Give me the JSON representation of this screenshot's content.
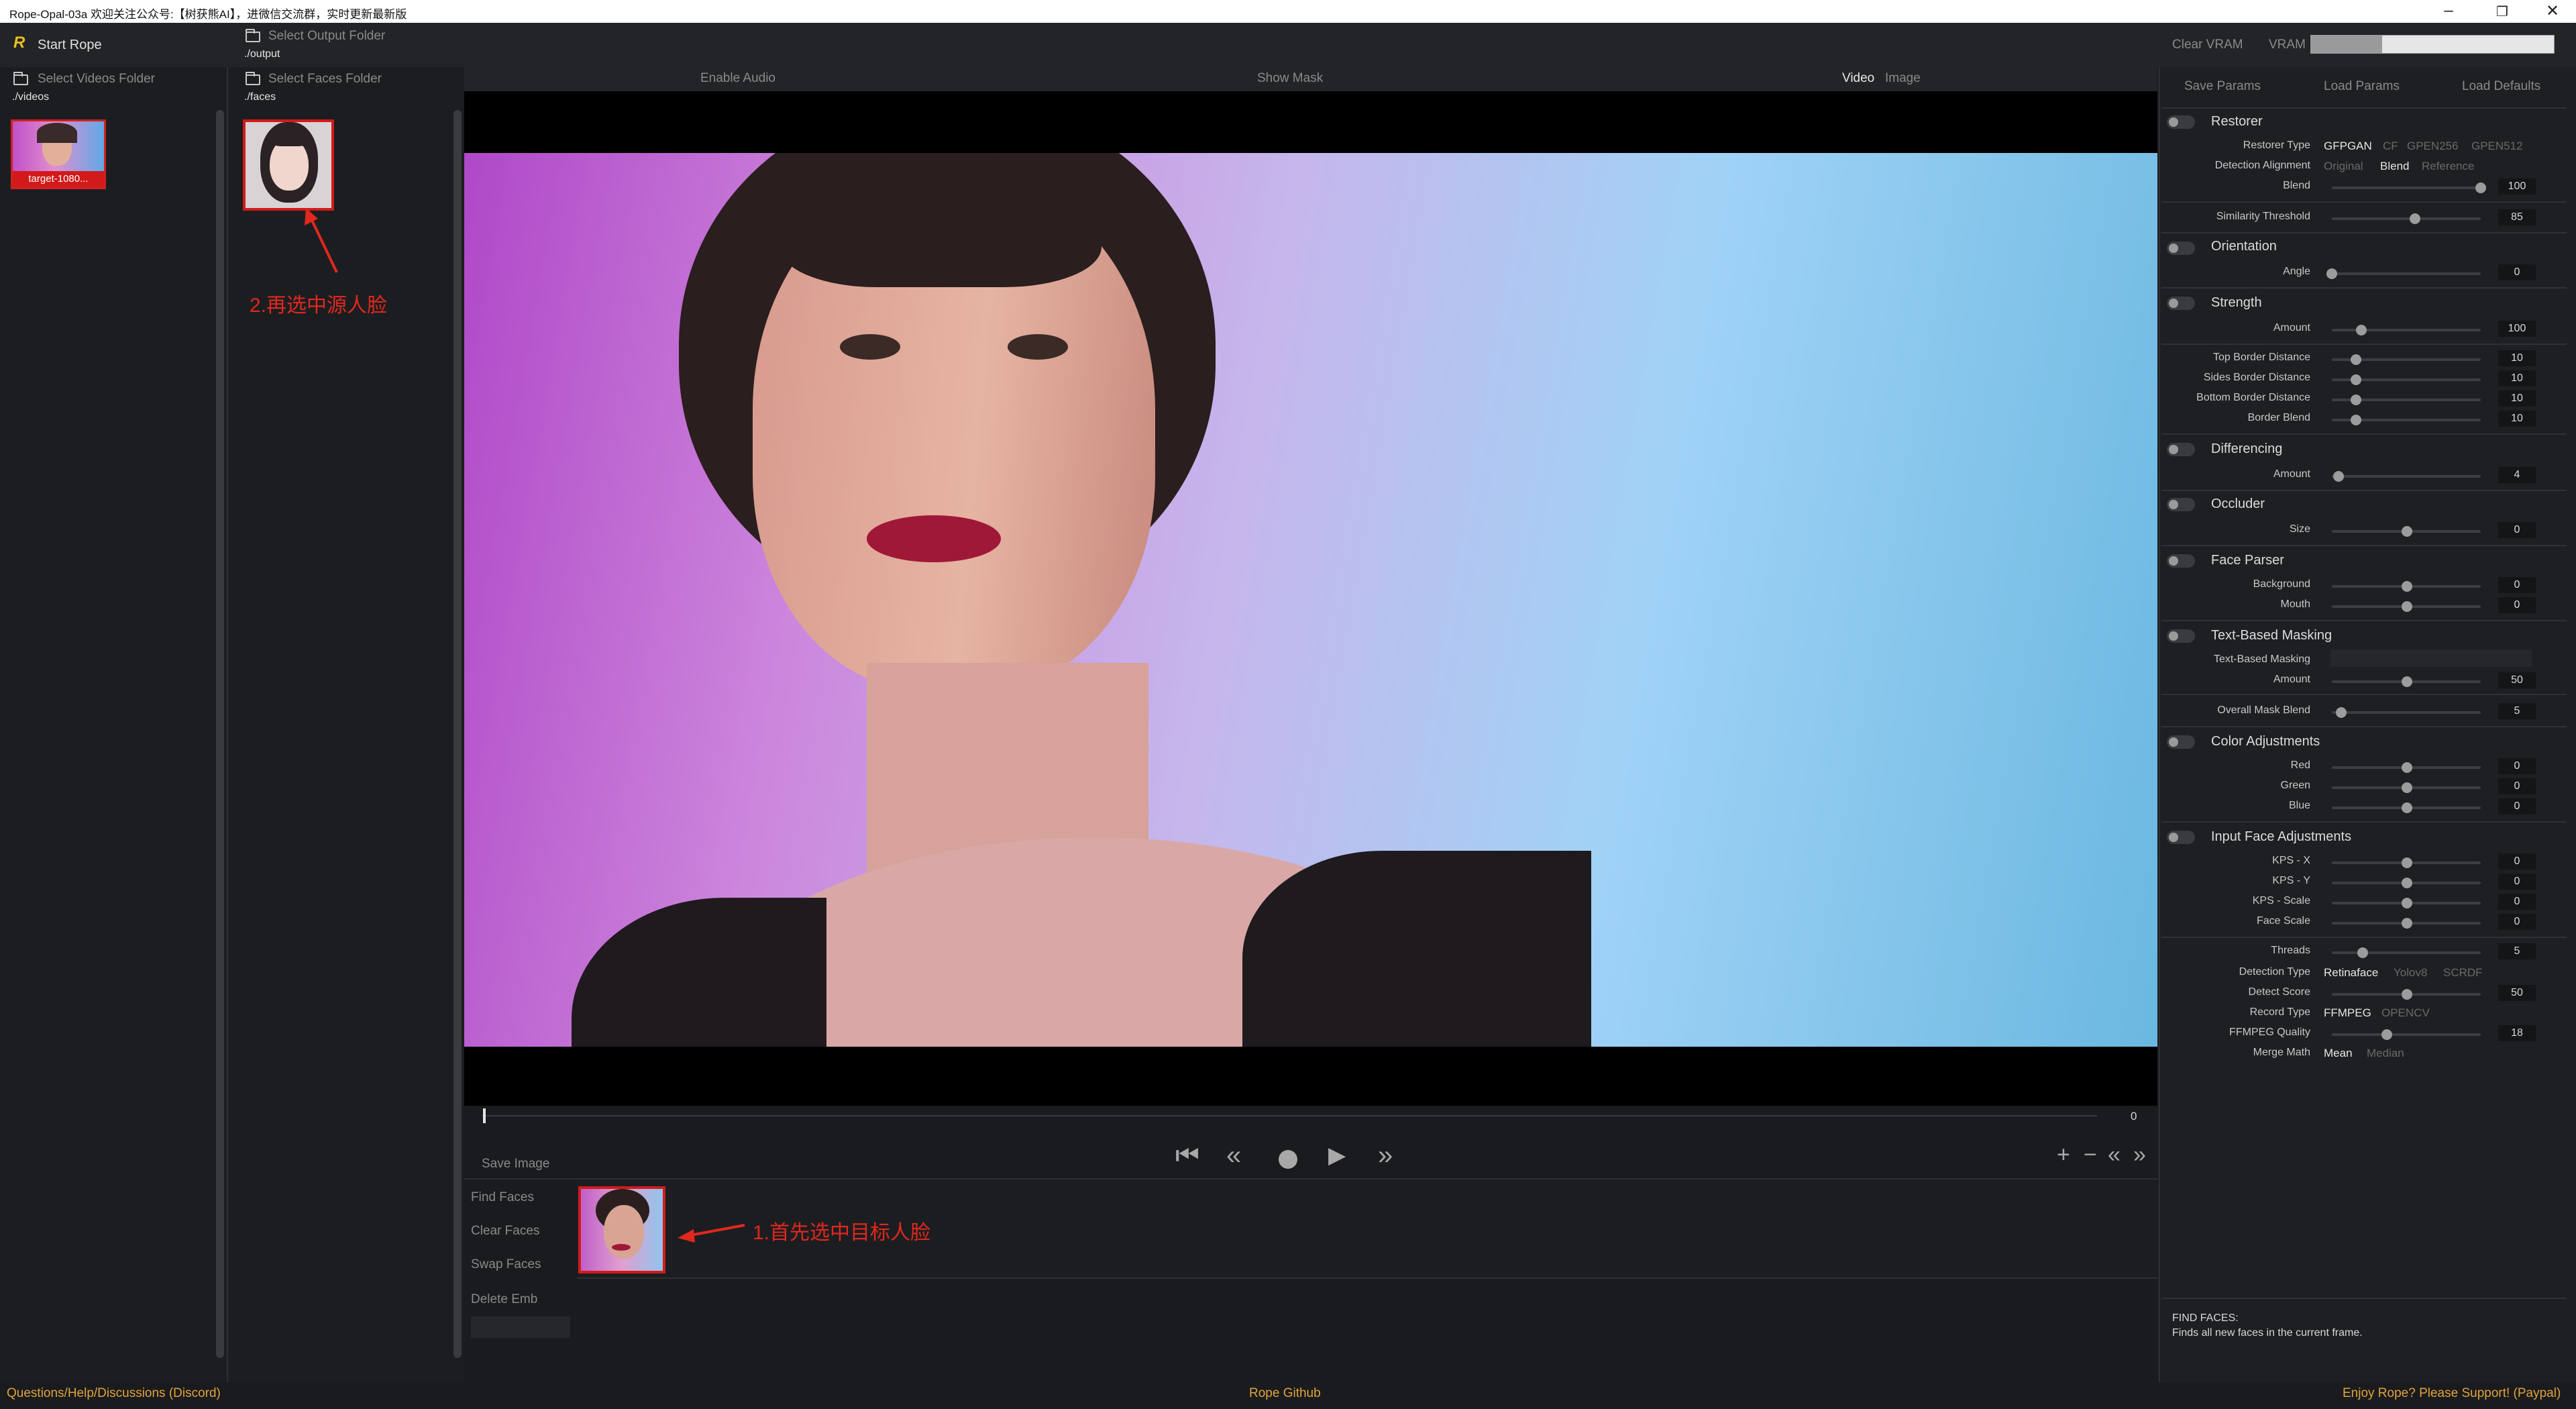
{
  "window": {
    "title": "Rope-Opal-03a  欢迎关注公众号:【树获熊AI】，进微信交流群，实时更新最新版"
  },
  "topbar": {
    "start_rope": "Start Rope",
    "select_output_folder": "Select Output Folder",
    "output_path": "./output",
    "clear_vram": "Clear VRAM",
    "vram_label": "VRAM"
  },
  "left": {
    "select_videos_folder": "Select Videos Folder",
    "videos_path": "./videos",
    "video_thumb_label": "target-1080...",
    "select_faces_folder": "Select Faces Folder",
    "faces_path": "./faces"
  },
  "center_top": {
    "enable_audio": "Enable Audio",
    "show_mask": "Show Mask",
    "video_tab": "Video",
    "image_tab": "Image"
  },
  "timeline": {
    "frame_value": "0"
  },
  "controls": {
    "save_image": "Save Image"
  },
  "faces": {
    "find_faces": "Find Faces",
    "clear_faces": "Clear Faces",
    "swap_faces": "Swap Faces",
    "delete_emb": "Delete Emb"
  },
  "annotations": {
    "source_face": "2.再选中源人脸",
    "target_face": "1.首先选中目标人脸",
    "color": "#e0281e"
  },
  "params_header": {
    "save_params": "Save Params",
    "load_params": "Load Params",
    "load_defaults": "Load Defaults"
  },
  "params": {
    "restorer": {
      "title": "Restorer",
      "type_label": "Restorer Type",
      "types": [
        "GFPGAN",
        "CF",
        "GPEN256",
        "GPEN512"
      ],
      "align_label": "Detection Alignment",
      "aligns": [
        "Original",
        "Blend",
        "Reference"
      ],
      "blend_label": "Blend",
      "blend": "100",
      "blend_level": 1.0
    },
    "similarity": {
      "label": "Similarity Threshold",
      "value": "85",
      "level": 0.55
    },
    "orientation": {
      "title": "Orientation",
      "angle_label": "Angle",
      "angle": "0",
      "level": 0.0
    },
    "strength": {
      "title": "Strength",
      "amount_label": "Amount",
      "amount": "100",
      "level": 0.2
    },
    "borders": {
      "top_label": "Top Border Distance",
      "top": "10",
      "sides_label": "Sides Border Distance",
      "sides": "10",
      "bottom_label": "Bottom Border Distance",
      "bottom": "10",
      "blend_label": "Border Blend",
      "blend": "10"
    },
    "differencing": {
      "title": "Differencing",
      "amount_label": "Amount",
      "amount": "4"
    },
    "occluder": {
      "title": "Occluder",
      "size_label": "Size",
      "size": "0"
    },
    "face_parser": {
      "title": "Face Parser",
      "background_label": "Background",
      "background": "0",
      "mouth_label": "Mouth",
      "mouth": "0"
    },
    "text_masking": {
      "title": "Text-Based Masking",
      "text_label": "Text-Based Masking",
      "amount_label": "Amount",
      "amount": "50"
    },
    "overall_mask": {
      "label": "Overall Mask Blend",
      "value": "5"
    },
    "color_adj": {
      "title": "Color Adjustments",
      "red_label": "Red",
      "red": "0",
      "green_label": "Green",
      "green": "0",
      "blue_label": "Blue",
      "blue": "0"
    },
    "input_face": {
      "title": "Input Face Adjustments",
      "kpsx_label": "KPS - X",
      "kpsx": "0",
      "kpsy_label": "KPS - Y",
      "kpsy": "0",
      "kpss_label": "KPS - Scale",
      "kpss": "0",
      "scale_label": "Face Scale",
      "scale": "0"
    },
    "threads": {
      "label": "Threads",
      "value": "5"
    },
    "detection_type": {
      "label": "Detection Type",
      "options": [
        "Retinaface",
        "Yolov8",
        "SCRDF"
      ]
    },
    "detect_score": {
      "label": "Detect Score",
      "value": "50"
    },
    "record_type": {
      "label": "Record Type",
      "options": [
        "FFMPEG",
        "OPENCV"
      ]
    },
    "ffmpeg_quality": {
      "label": "FFMPEG Quality",
      "value": "18"
    },
    "merge_math": {
      "label": "Merge Math",
      "options": [
        "Mean",
        "Median"
      ]
    }
  },
  "help": {
    "title": "FIND FACES:",
    "text": "Finds all new faces in the current frame."
  },
  "status": {
    "left": "Questions/Help/Discussions (Discord)",
    "center": "Rope Github",
    "right": "Enjoy Rope? Please Support! (Paypal)"
  }
}
